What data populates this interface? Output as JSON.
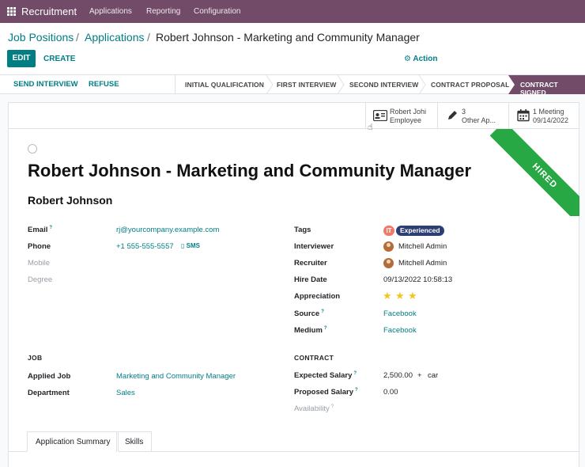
{
  "topbar": {
    "app_name": "Recruitment",
    "menu": [
      "Applications",
      "Reporting",
      "Configuration"
    ]
  },
  "breadcrumb": [
    "Job Positions",
    "Applications",
    "Robert Johnson - Marketing and Community Manager"
  ],
  "toolbar": {
    "edit_label": "EDIT",
    "create_label": "CREATE",
    "action_label": "Action"
  },
  "statusbar": {
    "send_interview": "SEND INTERVIEW",
    "refuse": "REFUSE",
    "stages": [
      "INITIAL QUALIFICATION",
      "FIRST INTERVIEW",
      "SECOND INTERVIEW",
      "CONTRACT PROPOSAL",
      "CONTRACT SIGNED"
    ],
    "active_stage": "CONTRACT SIGNED"
  },
  "smart_buttons": {
    "employee": {
      "line1": "Robert Johi",
      "line2": "Employee"
    },
    "other": {
      "line1": "3",
      "line2": "Other Ap..."
    },
    "meeting": {
      "line1": "1 Meeting",
      "line2": "09/14/2022"
    }
  },
  "ribbon": "HIRED",
  "record": {
    "title": "Robert Johnson - Marketing and Community Manager",
    "name": "Robert Johnson"
  },
  "left_fields": {
    "email_label": "Email",
    "email": "rj@yourcompany.example.com",
    "phone_label": "Phone",
    "phone": "+1 555-555-5557",
    "sms": "SMS",
    "mobile_label": "Mobile",
    "degree_label": "Degree"
  },
  "right_fields": {
    "tags_label": "Tags",
    "tags": [
      "IT",
      "Experienced"
    ],
    "interviewer_label": "Interviewer",
    "interviewer": "Mitchell Admin",
    "recruiter_label": "Recruiter",
    "recruiter": "Mitchell Admin",
    "hire_date_label": "Hire Date",
    "hire_date": "09/13/2022 10:58:13",
    "appreciation_label": "Appreciation",
    "appreciation_stars": 3,
    "source_label": "Source",
    "source": "Facebook",
    "medium_label": "Medium",
    "medium": "Facebook"
  },
  "job": {
    "section": "JOB",
    "applied_job_label": "Applied Job",
    "applied_job": "Marketing and Community Manager",
    "department_label": "Department",
    "department": "Sales"
  },
  "contract": {
    "section": "CONTRACT",
    "expected_salary_label": "Expected Salary",
    "expected_salary": "2,500.00",
    "plus": "+",
    "extra": "car",
    "proposed_salary_label": "Proposed Salary",
    "proposed_salary": "0.00",
    "availability_label": "Availability"
  },
  "tabs": [
    "Application Summary",
    "Skills"
  ],
  "colors": {
    "brand": "#714b67",
    "accent": "#017e84",
    "ribbon": "#28a745"
  }
}
